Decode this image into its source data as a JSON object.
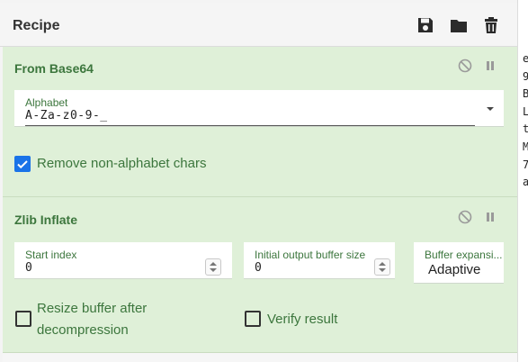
{
  "recipe": {
    "title": "Recipe",
    "icons": [
      "save-icon",
      "folder-icon",
      "trash-icon"
    ]
  },
  "operations": [
    {
      "name": "From Base64",
      "controls": [
        "disable-icon",
        "pause-icon"
      ],
      "alphabet": {
        "label": "Alphabet",
        "value": "A-Za-z0-9-_"
      },
      "remove_non_alphabet": {
        "label": "Remove non-alphabet chars",
        "checked": true
      }
    },
    {
      "name": "Zlib Inflate",
      "controls": [
        "disable-icon",
        "pause-icon"
      ],
      "start_index": {
        "label": "Start index",
        "value": "0"
      },
      "initial_buffer": {
        "label": "Initial output buffer size",
        "value": "0"
      },
      "buffer_expansion": {
        "label": "Buffer expansi...",
        "value": "Adaptive"
      },
      "resize_buffer": {
        "label_line1": "Resize buffer after",
        "label_line2": "decompression",
        "checked": false
      },
      "verify_result": {
        "label": "Verify result",
        "checked": false
      }
    }
  ],
  "io_text": [
    "e",
    "9",
    "B",
    "L",
    "t",
    "M",
    "7",
    "a"
  ],
  "colors": {
    "op_bg": "#dff0d8",
    "op_text": "#3c763d",
    "checkbox": "#1a73e8"
  }
}
